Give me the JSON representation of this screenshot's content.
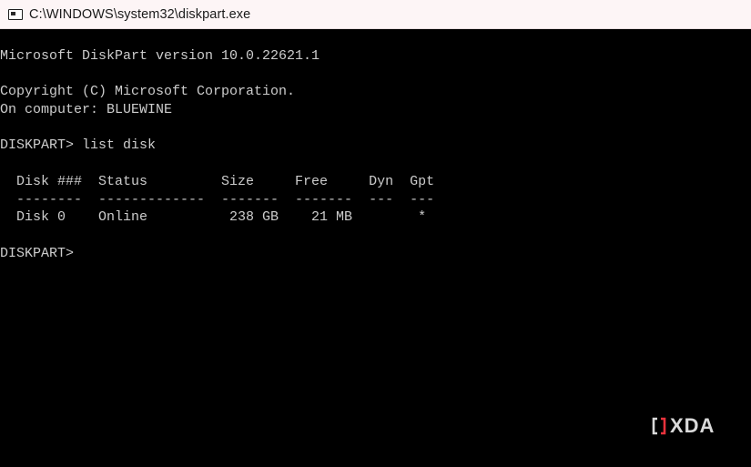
{
  "window": {
    "title": "C:\\WINDOWS\\system32\\diskpart.exe",
    "icon": "console-window-icon"
  },
  "console": {
    "lines": [
      "Microsoft DiskPart version 10.0.22621.1",
      "",
      "Copyright (C) Microsoft Corporation.",
      "On computer: BLUEWINE",
      "",
      "DISKPART> list disk",
      "",
      "  Disk ###  Status         Size     Free     Dyn  Gpt",
      "  --------  -------------  -------  -------  ---  ---",
      "  Disk 0    Online          238 GB    21 MB        *",
      "",
      "DISKPART> "
    ],
    "text_color": "#cccccc",
    "background": "#000000"
  },
  "disk_table": {
    "headers": [
      "Disk ###",
      "Status",
      "Size",
      "Free",
      "Dyn",
      "Gpt"
    ],
    "rows": [
      [
        "Disk 0",
        "Online",
        "238 GB",
        "21 MB",
        "",
        "*"
      ]
    ]
  },
  "watermark": {
    "text": "XDA",
    "mark_colors": [
      "#d9d9d9",
      "#e8323c"
    ]
  }
}
